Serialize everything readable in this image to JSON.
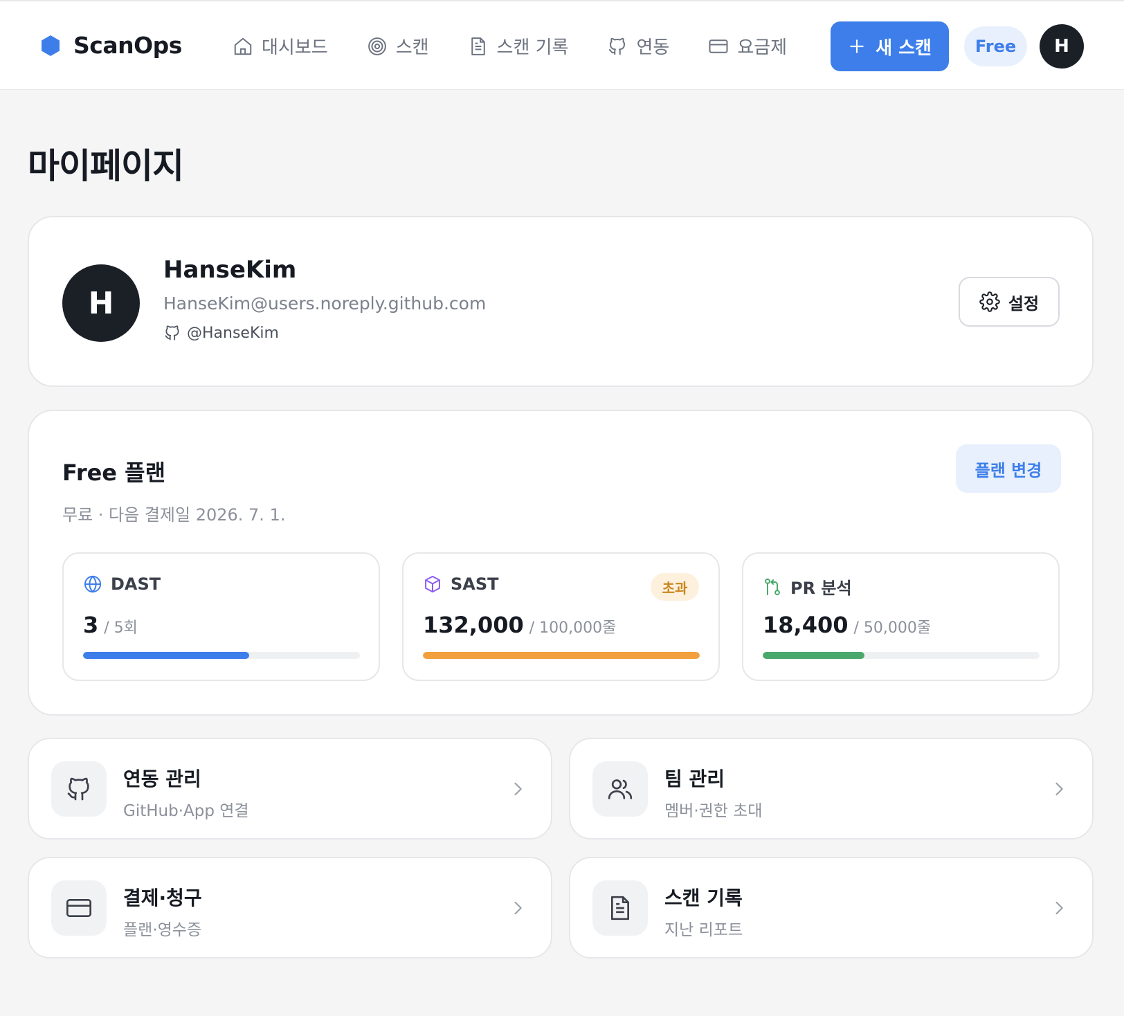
{
  "app": {
    "name": "ScanOps",
    "nav": [
      {
        "label": "대시보드",
        "icon": "home-icon"
      },
      {
        "label": "스캔",
        "icon": "target-icon"
      },
      {
        "label": "스캔 기록",
        "icon": "file-icon"
      },
      {
        "label": "연동",
        "icon": "github-icon"
      },
      {
        "label": "요금제",
        "icon": "credit-card-icon"
      }
    ],
    "new_scan_label": "새 스캔",
    "plan_badge": "Free",
    "avatar_initial": "H"
  },
  "page": {
    "title": "마이페이지"
  },
  "profile": {
    "initial": "H",
    "name": "HanseKim",
    "email": "HanseKim@users.noreply.github.com",
    "handle": "@HanseKim",
    "settings_label": "설정"
  },
  "plan": {
    "title": "Free 플랜",
    "subtitle": "무료 · 다음 결제일 2026. 7. 1.",
    "change_label": "플랜 변경",
    "usage": [
      {
        "label": "DAST",
        "used": "3",
        "limit": "/ 5회",
        "fraction": 0.6,
        "color": "#3d7eea",
        "icon": "globe-icon",
        "badge": ""
      },
      {
        "label": "SAST",
        "used": "132,000",
        "limit": "/ 100,000줄",
        "fraction": 1.0,
        "color": "#f2a03d",
        "icon": "cube-icon",
        "badge": "초과"
      },
      {
        "label": "PR 분석",
        "used": "18,400",
        "limit": "/ 50,000줄",
        "fraction": 0.368,
        "color": "#4aa86c",
        "icon": "git-pull-request-icon",
        "badge": ""
      }
    ]
  },
  "links": [
    {
      "title": "연동 관리",
      "subtitle": "GitHub·App 연결",
      "icon": "github-icon"
    },
    {
      "title": "팀 관리",
      "subtitle": "멤버·권한 초대",
      "icon": "users-icon"
    },
    {
      "title": "결제·청구",
      "subtitle": "플랜·영수증",
      "icon": "credit-card-icon"
    },
    {
      "title": "스캔 기록",
      "subtitle": "지난 리포트",
      "icon": "file-icon"
    }
  ],
  "colors": {
    "accent": "#3d7eea",
    "dark": "#1b1f26",
    "warning": "#f2a03d",
    "success": "#4aa86c",
    "sast_icon": "#8a5cf0"
  }
}
